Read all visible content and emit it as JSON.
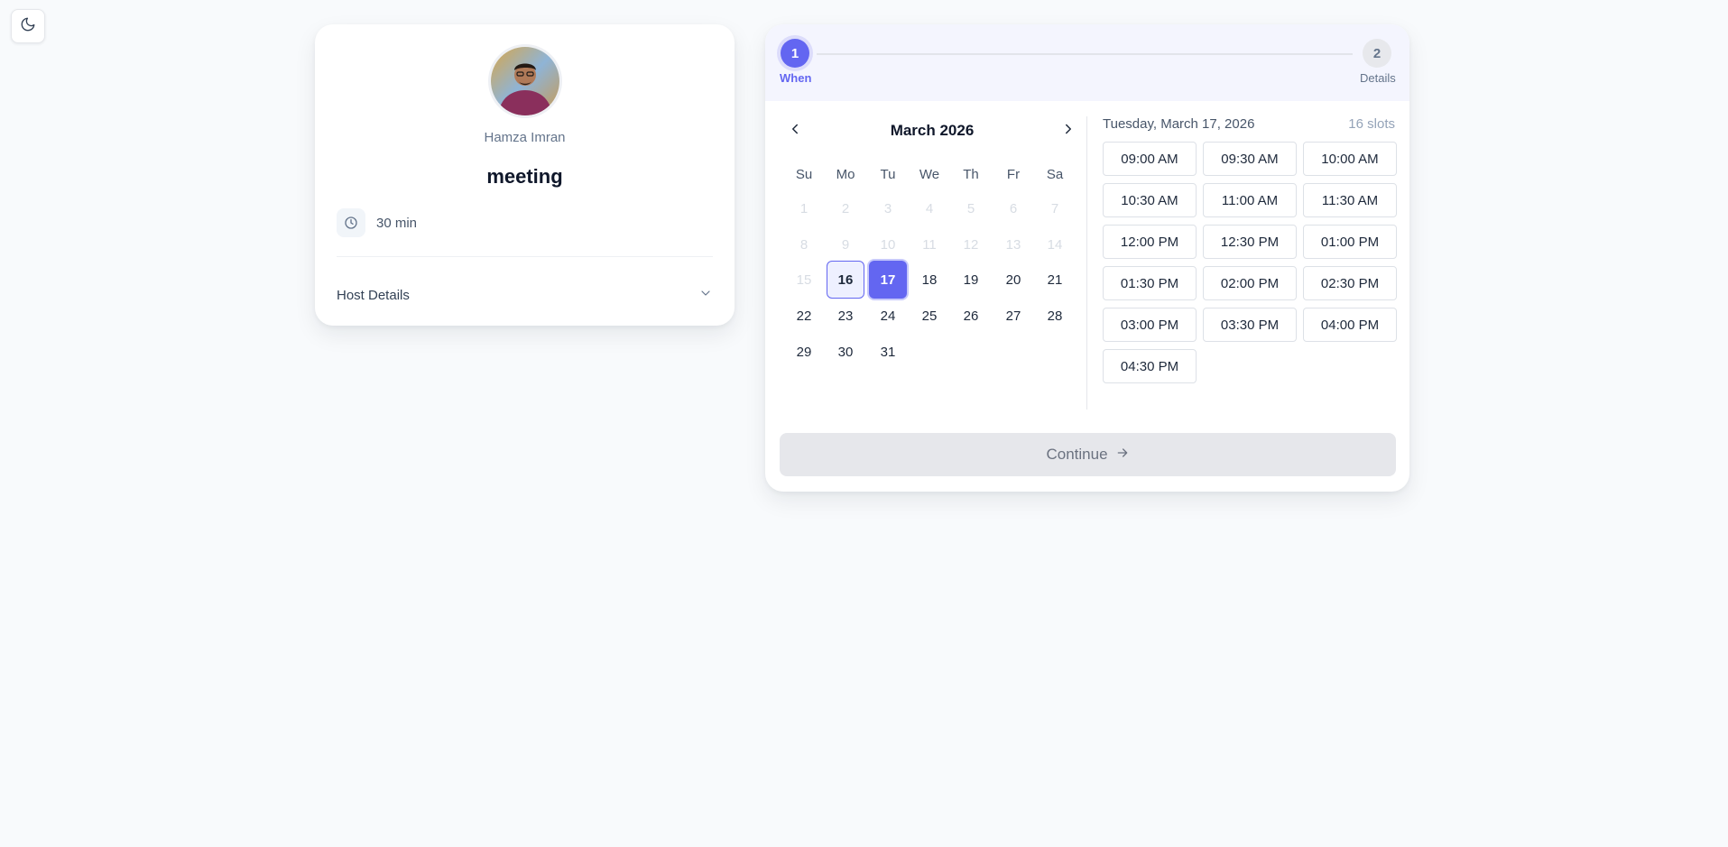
{
  "theme_toggle": {
    "icon": "moon-icon"
  },
  "host": {
    "name": "Hamza Imran",
    "event_title": "meeting",
    "duration": "30 min",
    "details_label": "Host Details"
  },
  "stepper": {
    "steps": [
      {
        "number": "1",
        "label": "When",
        "active": true
      },
      {
        "number": "2",
        "label": "Details",
        "active": false
      }
    ]
  },
  "calendar": {
    "month_label": "March 2026",
    "weekdays": [
      "Su",
      "Mo",
      "Tu",
      "We",
      "Th",
      "Fr",
      "Sa"
    ],
    "days": [
      "1",
      "2",
      "3",
      "4",
      "5",
      "6",
      "7",
      "8",
      "9",
      "10",
      "11",
      "12",
      "13",
      "14",
      "15",
      "16",
      "17",
      "18",
      "19",
      "20",
      "21",
      "22",
      "23",
      "24",
      "25",
      "26",
      "27",
      "28",
      "29",
      "30",
      "31"
    ],
    "disabled_through": 15,
    "today": 16,
    "selected": 17
  },
  "slots_panel": {
    "date_label": "Tuesday, March 17, 2026",
    "count_label": "16 slots",
    "slots": [
      "09:00 AM",
      "09:30 AM",
      "10:00 AM",
      "10:30 AM",
      "11:00 AM",
      "11:30 AM",
      "12:00 PM",
      "12:30 PM",
      "01:00 PM",
      "01:30 PM",
      "02:00 PM",
      "02:30 PM",
      "03:00 PM",
      "03:30 PM",
      "04:00 PM",
      "04:30 PM"
    ]
  },
  "continue_label": "Continue",
  "colors": {
    "accent": "#6366f1",
    "background": "#f8fafc",
    "disabled_button": "#e6e7eb"
  }
}
